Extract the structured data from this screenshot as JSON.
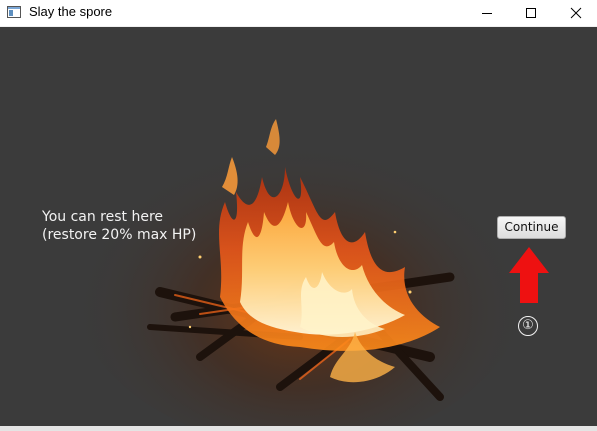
{
  "window": {
    "title": "Slay the spore",
    "icon": "app-window-icon",
    "controls": [
      "minimize-icon",
      "maximize-icon",
      "close-icon"
    ]
  },
  "scene": {
    "background_image": "campfire",
    "rest_line1": "You can rest here",
    "rest_line2": "(restore 20% max HP)",
    "continue_label": "Continue",
    "annotation_arrow": "red-up-arrow",
    "annotation_step": "①"
  },
  "colors": {
    "scene_bg": "#3b3b3b",
    "text": "#f2f2f2",
    "arrow": "#ee1111"
  }
}
